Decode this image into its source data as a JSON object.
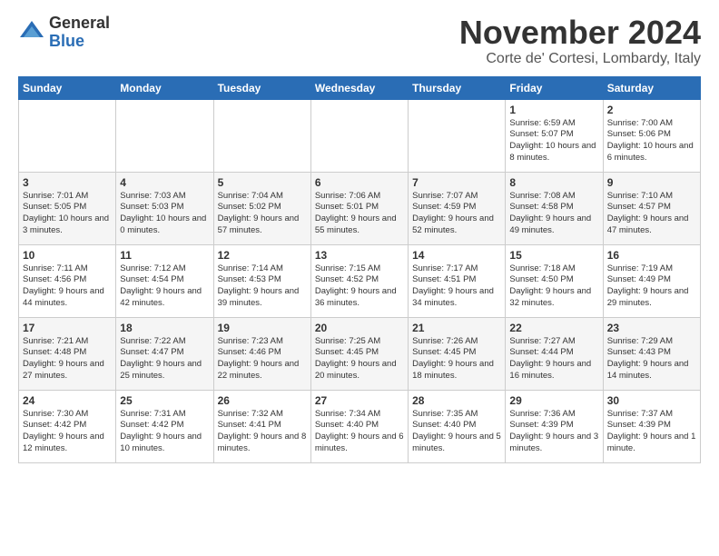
{
  "logo": {
    "general": "General",
    "blue": "Blue"
  },
  "header": {
    "month": "November 2024",
    "location": "Corte de' Cortesi, Lombardy, Italy"
  },
  "days_of_week": [
    "Sunday",
    "Monday",
    "Tuesday",
    "Wednesday",
    "Thursday",
    "Friday",
    "Saturday"
  ],
  "weeks": [
    [
      {
        "day": "",
        "info": ""
      },
      {
        "day": "",
        "info": ""
      },
      {
        "day": "",
        "info": ""
      },
      {
        "day": "",
        "info": ""
      },
      {
        "day": "",
        "info": ""
      },
      {
        "day": "1",
        "info": "Sunrise: 6:59 AM\nSunset: 5:07 PM\nDaylight: 10 hours and 8 minutes."
      },
      {
        "day": "2",
        "info": "Sunrise: 7:00 AM\nSunset: 5:06 PM\nDaylight: 10 hours and 6 minutes."
      }
    ],
    [
      {
        "day": "3",
        "info": "Sunrise: 7:01 AM\nSunset: 5:05 PM\nDaylight: 10 hours and 3 minutes."
      },
      {
        "day": "4",
        "info": "Sunrise: 7:03 AM\nSunset: 5:03 PM\nDaylight: 10 hours and 0 minutes."
      },
      {
        "day": "5",
        "info": "Sunrise: 7:04 AM\nSunset: 5:02 PM\nDaylight: 9 hours and 57 minutes."
      },
      {
        "day": "6",
        "info": "Sunrise: 7:06 AM\nSunset: 5:01 PM\nDaylight: 9 hours and 55 minutes."
      },
      {
        "day": "7",
        "info": "Sunrise: 7:07 AM\nSunset: 4:59 PM\nDaylight: 9 hours and 52 minutes."
      },
      {
        "day": "8",
        "info": "Sunrise: 7:08 AM\nSunset: 4:58 PM\nDaylight: 9 hours and 49 minutes."
      },
      {
        "day": "9",
        "info": "Sunrise: 7:10 AM\nSunset: 4:57 PM\nDaylight: 9 hours and 47 minutes."
      }
    ],
    [
      {
        "day": "10",
        "info": "Sunrise: 7:11 AM\nSunset: 4:56 PM\nDaylight: 9 hours and 44 minutes."
      },
      {
        "day": "11",
        "info": "Sunrise: 7:12 AM\nSunset: 4:54 PM\nDaylight: 9 hours and 42 minutes."
      },
      {
        "day": "12",
        "info": "Sunrise: 7:14 AM\nSunset: 4:53 PM\nDaylight: 9 hours and 39 minutes."
      },
      {
        "day": "13",
        "info": "Sunrise: 7:15 AM\nSunset: 4:52 PM\nDaylight: 9 hours and 36 minutes."
      },
      {
        "day": "14",
        "info": "Sunrise: 7:17 AM\nSunset: 4:51 PM\nDaylight: 9 hours and 34 minutes."
      },
      {
        "day": "15",
        "info": "Sunrise: 7:18 AM\nSunset: 4:50 PM\nDaylight: 9 hours and 32 minutes."
      },
      {
        "day": "16",
        "info": "Sunrise: 7:19 AM\nSunset: 4:49 PM\nDaylight: 9 hours and 29 minutes."
      }
    ],
    [
      {
        "day": "17",
        "info": "Sunrise: 7:21 AM\nSunset: 4:48 PM\nDaylight: 9 hours and 27 minutes."
      },
      {
        "day": "18",
        "info": "Sunrise: 7:22 AM\nSunset: 4:47 PM\nDaylight: 9 hours and 25 minutes."
      },
      {
        "day": "19",
        "info": "Sunrise: 7:23 AM\nSunset: 4:46 PM\nDaylight: 9 hours and 22 minutes."
      },
      {
        "day": "20",
        "info": "Sunrise: 7:25 AM\nSunset: 4:45 PM\nDaylight: 9 hours and 20 minutes."
      },
      {
        "day": "21",
        "info": "Sunrise: 7:26 AM\nSunset: 4:45 PM\nDaylight: 9 hours and 18 minutes."
      },
      {
        "day": "22",
        "info": "Sunrise: 7:27 AM\nSunset: 4:44 PM\nDaylight: 9 hours and 16 minutes."
      },
      {
        "day": "23",
        "info": "Sunrise: 7:29 AM\nSunset: 4:43 PM\nDaylight: 9 hours and 14 minutes."
      }
    ],
    [
      {
        "day": "24",
        "info": "Sunrise: 7:30 AM\nSunset: 4:42 PM\nDaylight: 9 hours and 12 minutes."
      },
      {
        "day": "25",
        "info": "Sunrise: 7:31 AM\nSunset: 4:42 PM\nDaylight: 9 hours and 10 minutes."
      },
      {
        "day": "26",
        "info": "Sunrise: 7:32 AM\nSunset: 4:41 PM\nDaylight: 9 hours and 8 minutes."
      },
      {
        "day": "27",
        "info": "Sunrise: 7:34 AM\nSunset: 4:40 PM\nDaylight: 9 hours and 6 minutes."
      },
      {
        "day": "28",
        "info": "Sunrise: 7:35 AM\nSunset: 4:40 PM\nDaylight: 9 hours and 5 minutes."
      },
      {
        "day": "29",
        "info": "Sunrise: 7:36 AM\nSunset: 4:39 PM\nDaylight: 9 hours and 3 minutes."
      },
      {
        "day": "30",
        "info": "Sunrise: 7:37 AM\nSunset: 4:39 PM\nDaylight: 9 hours and 1 minute."
      }
    ]
  ]
}
